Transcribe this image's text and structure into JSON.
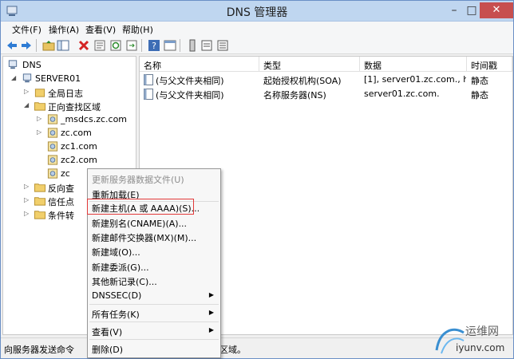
{
  "window": {
    "title": "DNS 管理器",
    "min": "–",
    "max": "□",
    "close": "✕"
  },
  "menubar": [
    "文件(F)",
    "操作(A)",
    "查看(V)",
    "帮助(H)"
  ],
  "toolbar": [
    "back-icon",
    "forward-icon",
    "up-folder-icon",
    "show-hide-tree-icon",
    "delete-icon",
    "properties-icon",
    "refresh-icon",
    "export-icon",
    "help-icon",
    "console-icon",
    "server-icon",
    "list-icon",
    "details-icon"
  ],
  "tree": {
    "root": "DNS",
    "server": "SERVER01",
    "items": {
      "global_logs": "全局日志",
      "forward_zones": "正向查找区域",
      "msdcs": "_msdcs.zc.com",
      "zc": "zc.com",
      "zc1": "zc1.com",
      "zc2": "zc2.com",
      "zc3": "zc",
      "reverse": "反向查",
      "trust": "信任点",
      "conditional": "条件转"
    }
  },
  "list": {
    "columns": [
      "名称",
      "类型",
      "数据",
      "时间戳"
    ],
    "rows": [
      [
        "(与父文件夹相同)",
        "起始授权机构(SOA)",
        "[1], server01.zc.com., h...",
        "静态"
      ],
      [
        "(与父文件夹相同)",
        "名称服务器(NS)",
        "server01.zc.com.",
        "静态"
      ]
    ]
  },
  "context_menu": {
    "update": "更新服务器数据文件(U)",
    "reload": "重新加载(E)",
    "new_host": "新建主机(A 或 AAAA)(S)...",
    "new_alias": "新建别名(CNAME)(A)...",
    "new_mx": "新建邮件交换器(MX)(M)...",
    "new_domain": "新建域(O)...",
    "new_delegation": "新建委派(G)...",
    "other_records": "其他新记录(C)...",
    "dnssec": "DNSSEC(D)",
    "all_tasks": "所有任务(K)",
    "view": "查看(V)",
    "delete": "删除(D)"
  },
  "status": {
    "text": "向服务器发送命令",
    "tail": "区域。"
  },
  "watermark": {
    "brand": "运维网",
    "url": "iyunv.com"
  },
  "colors": {
    "accent": "#bfd6f0",
    "close": "#c74f4f",
    "highlight": "#e23a3a"
  }
}
